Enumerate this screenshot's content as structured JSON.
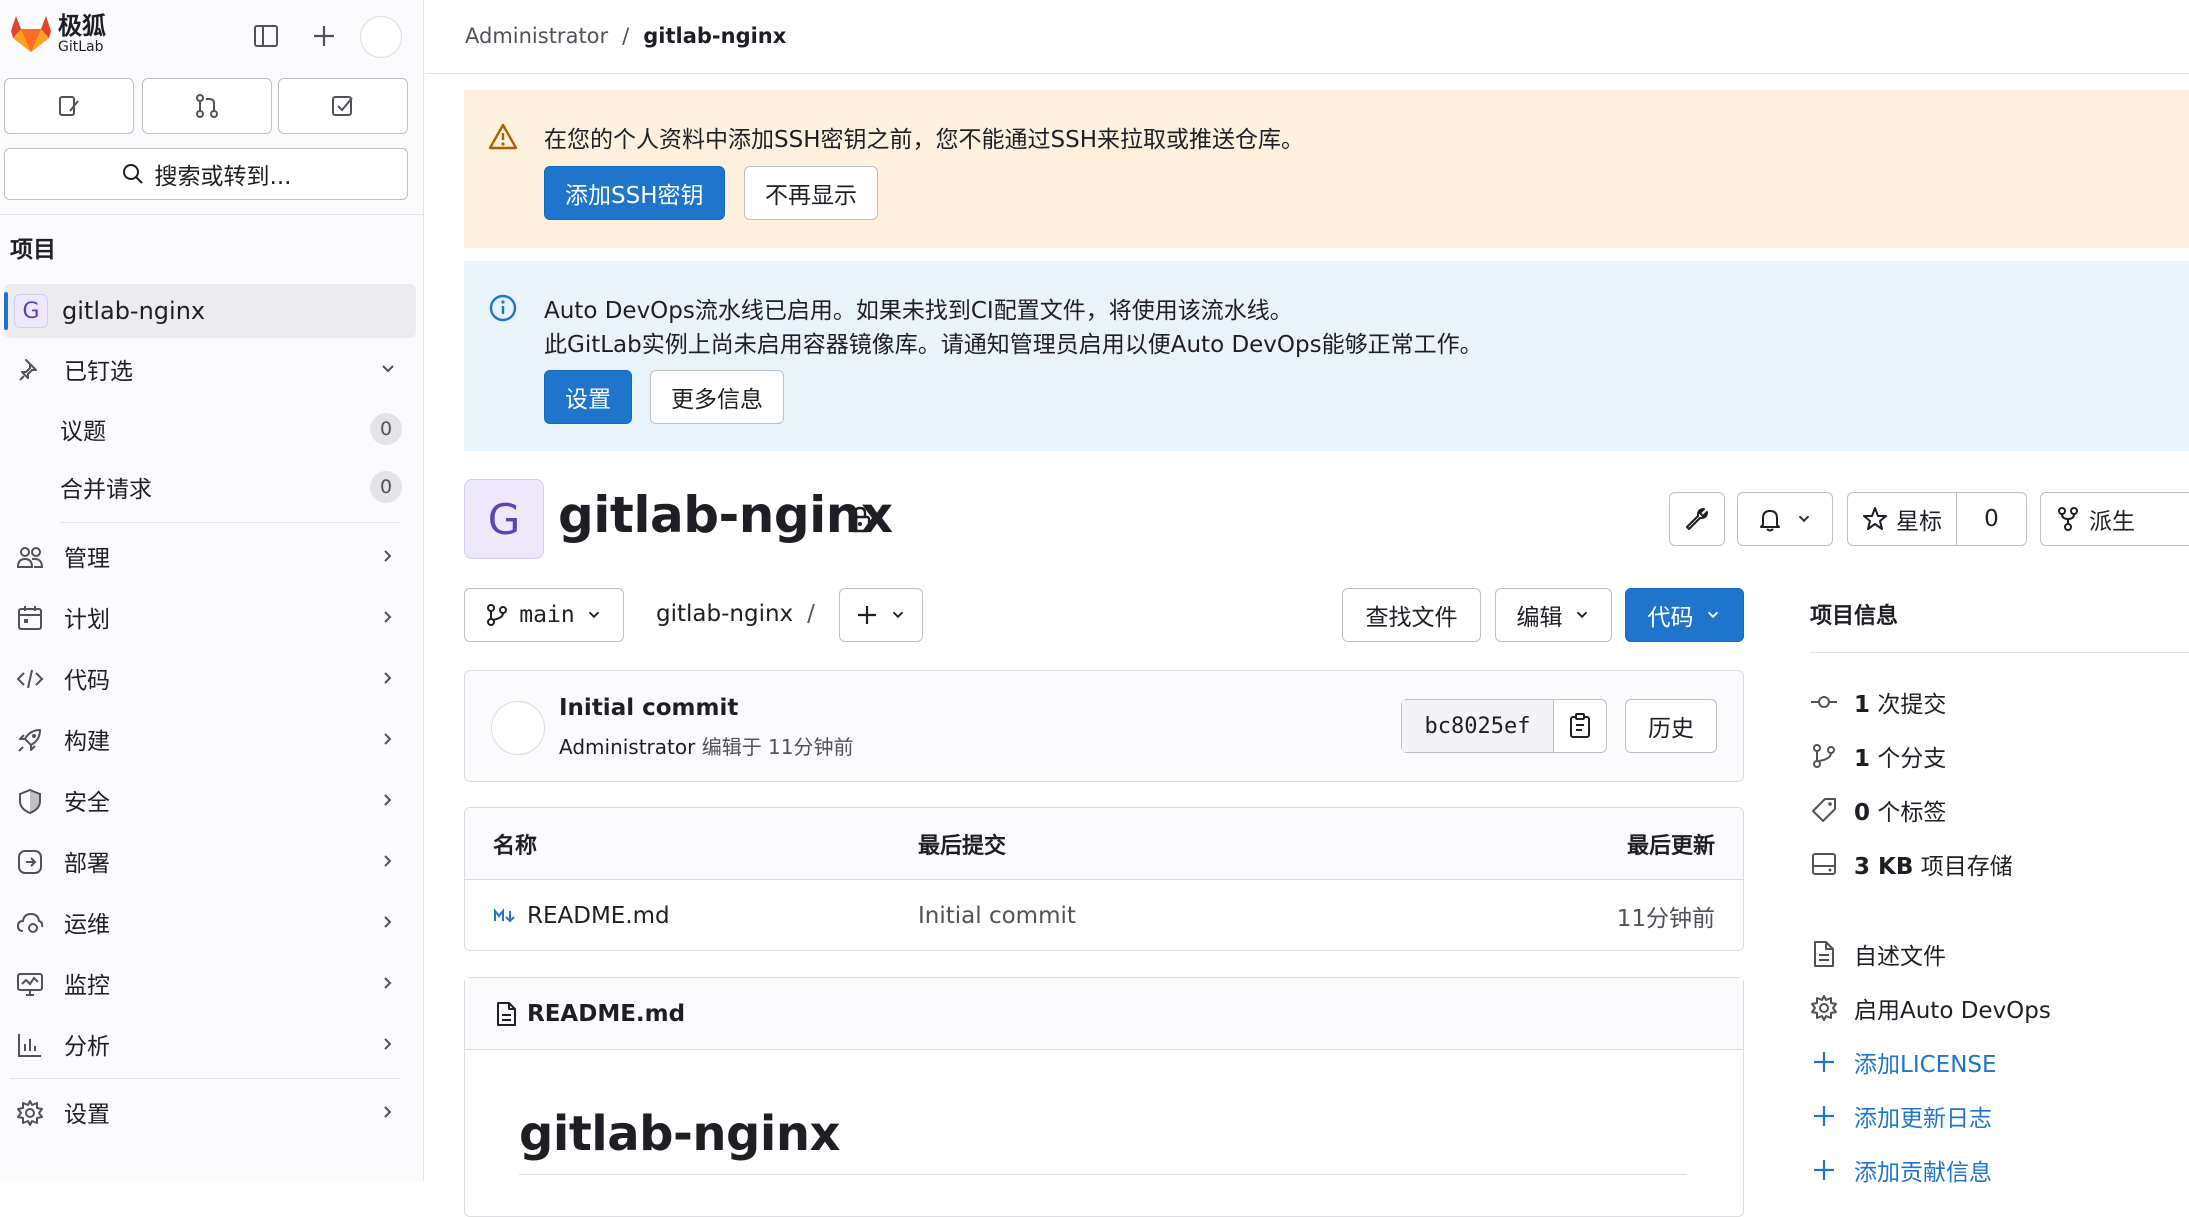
{
  "brand": {
    "name_cn": "极狐",
    "name_en": "GitLab"
  },
  "sidebar": {
    "search_label": "搜索或转到...",
    "section_heading": "项目",
    "project_badge": "G",
    "project_name": "gitlab-nginx",
    "pinned_label": "已钉选",
    "pinned": [
      {
        "label": "议题",
        "count": "0"
      },
      {
        "label": "合并请求",
        "count": "0"
      }
    ],
    "nav": [
      {
        "label": "管理",
        "icon": "users-icon"
      },
      {
        "label": "计划",
        "icon": "calendar-icon"
      },
      {
        "label": "代码",
        "icon": "code-icon"
      },
      {
        "label": "构建",
        "icon": "rocket-icon"
      },
      {
        "label": "安全",
        "icon": "shield-icon"
      },
      {
        "label": "部署",
        "icon": "deploy-icon"
      },
      {
        "label": "运维",
        "icon": "cloud-gear-icon"
      },
      {
        "label": "监控",
        "icon": "monitor-icon"
      },
      {
        "label": "分析",
        "icon": "chart-icon"
      }
    ],
    "settings_label": "设置"
  },
  "breadcrumb": {
    "parent": "Administrator",
    "separator": "/",
    "current": "gitlab-nginx"
  },
  "alerts": {
    "ssh": {
      "message": "在您的个人资料中添加SSH密钥之前，您不能通过SSH来拉取或推送仓库。",
      "primary": "添加SSH密钥",
      "secondary": "不再显示"
    },
    "devops": {
      "line1": "Auto DevOps流水线已启用。如果未找到CI配置文件，将使用该流水线。",
      "line2": "此GitLab实例上尚未启用容器镜像库。请通知管理员启用以便Auto DevOps能够正常工作。",
      "primary": "设置",
      "secondary": "更多信息"
    }
  },
  "project": {
    "avatar_letter": "G",
    "title": "gitlab-nginx",
    "star_label": "星标",
    "star_count": "0",
    "fork_label": "派生"
  },
  "repo": {
    "branch": "main",
    "path": "gitlab-nginx",
    "path_sep": "/",
    "find_file": "查找文件",
    "edit": "编辑",
    "code": "代码"
  },
  "commit": {
    "title": "Initial commit",
    "author": "Administrator",
    "meta": "编辑于 11分钟前",
    "sha": "bc8025ef",
    "history": "历史"
  },
  "files": {
    "headers": {
      "name": "名称",
      "last_commit": "最后提交",
      "last_update": "最后更新"
    },
    "rows": [
      {
        "name": "README.md",
        "commit": "Initial commit",
        "updated": "11分钟前"
      }
    ]
  },
  "readme": {
    "filename": "README.md",
    "heading": "gitlab-nginx"
  },
  "project_info": {
    "title": "项目信息",
    "stats": [
      {
        "value": "1",
        "label": "次提交",
        "icon": "commit-icon"
      },
      {
        "value": "1",
        "label": "个分支",
        "icon": "branch-icon"
      },
      {
        "value": "0",
        "label": "个标签",
        "icon": "tag-icon"
      },
      {
        "value": "3 KB",
        "label": "项目存储",
        "icon": "storage-icon"
      }
    ],
    "links": [
      {
        "label": "自述文件",
        "icon": "doc-icon"
      },
      {
        "label": "启用Auto DevOps",
        "icon": "settings-icon"
      },
      {
        "label": "添加LICENSE",
        "icon": "plus-icon"
      },
      {
        "label": "添加更新日志",
        "icon": "plus-icon"
      },
      {
        "label": "添加贡献信息",
        "icon": "plus-icon"
      }
    ]
  },
  "colors": {
    "primary": "#1f75cb",
    "warning_bg": "#fdf1dd",
    "info_bg": "#e9f3fc",
    "brand_orange": "#e24329"
  }
}
